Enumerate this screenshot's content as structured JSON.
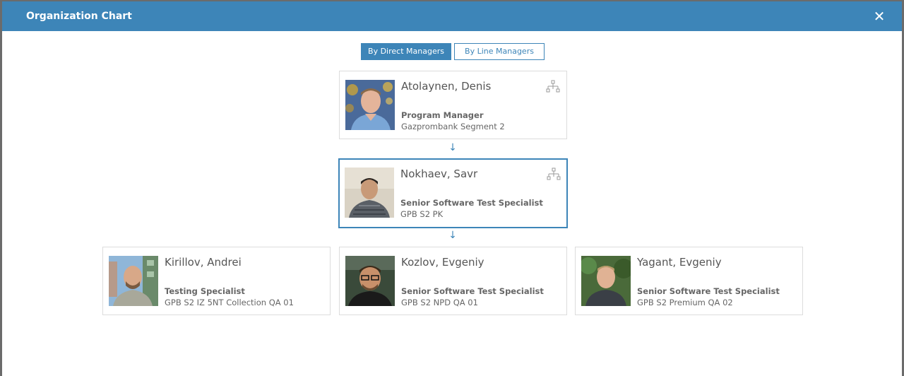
{
  "window": {
    "title": "Organization Chart",
    "close_glyph": "✕"
  },
  "view_toggle": {
    "direct_label": "By Direct Managers",
    "line_label": "By Line Managers",
    "active": "direct"
  },
  "colors": {
    "accent": "#3d85b8",
    "card_border": "#dcdcdc",
    "text": "#555555"
  },
  "chain": [
    {
      "name": "Atolaynen, Denis",
      "role": "Program Manager",
      "unit": "Gazprombank Segment 2",
      "selected": false
    },
    {
      "name": "Nokhaev, Savr",
      "role": "Senior Software Test Specialist",
      "unit": "GPB S2 PK",
      "selected": true
    }
  ],
  "reports": [
    {
      "name": "Kirillov, Andrei",
      "role": "Testing Specialist",
      "unit": "GPB S2 IZ 5NT Collection QA 01"
    },
    {
      "name": "Kozlov, Evgeniy",
      "role": "Senior Software Test Specialist",
      "unit": "GPB S2 NPD QA 01"
    },
    {
      "name": "Yagant, Evgeniy",
      "role": "Senior Software Test Specialist",
      "unit": "GPB S2 Premium QA 02"
    }
  ],
  "connector_glyph": "↓"
}
